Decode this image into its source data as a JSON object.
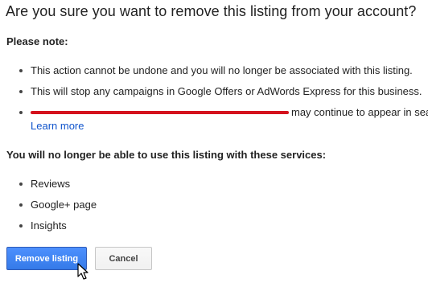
{
  "dialog": {
    "title": "Are you sure you want to remove this listing from your account?",
    "note_heading": "Please note:",
    "notes": [
      "This action cannot be undone and you will no longer be associated with this listing.",
      "This will stop any campaigns in Google Offers or AdWords Express for this business."
    ],
    "redacted_note_tail": "may continue to appear in sea",
    "learn_more": "Learn more",
    "services_heading": "You will no longer be able to use this listing with these services:",
    "services": [
      "Reviews",
      "Google+ page",
      "Insights"
    ],
    "remove_button": "Remove listing",
    "cancel_button": "Cancel"
  },
  "colors": {
    "primary_button": "#4d90fe",
    "link": "#1155cc",
    "redaction": "#d4121d"
  },
  "icons": {
    "cursor": "mouse-pointer-icon"
  }
}
